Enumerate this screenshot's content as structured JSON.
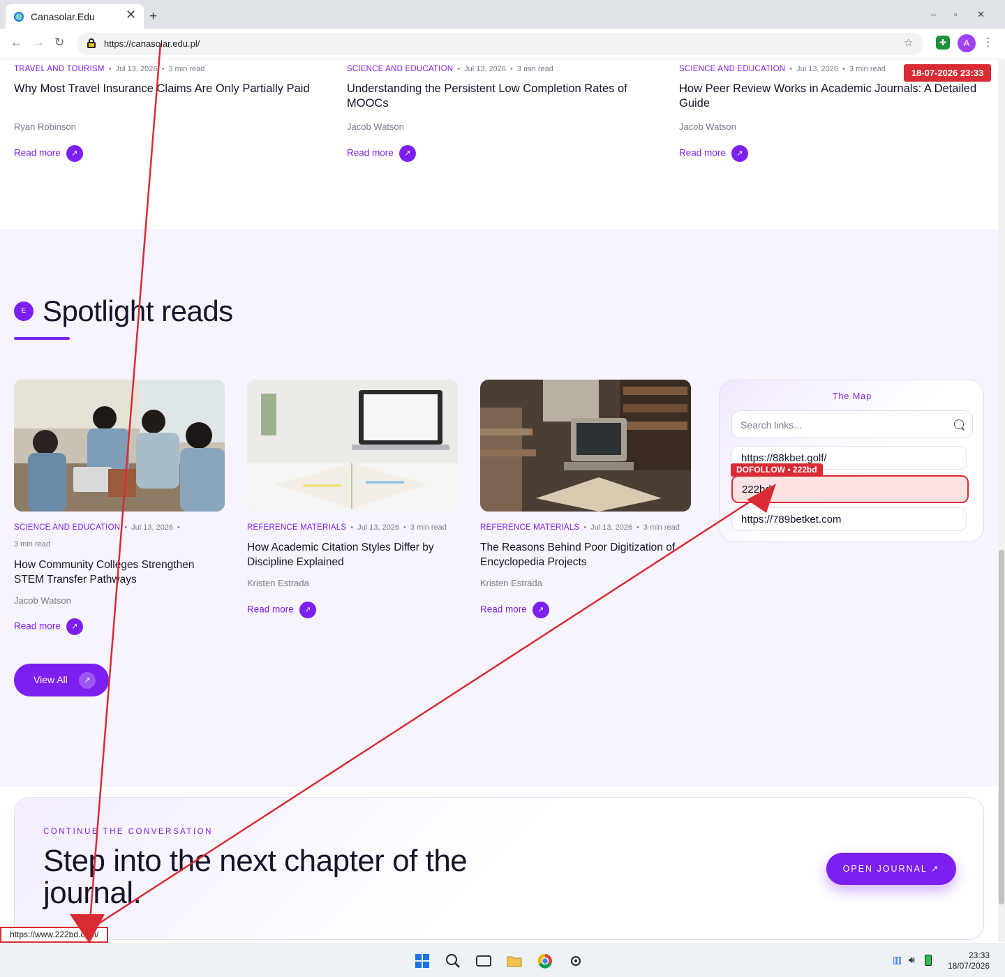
{
  "browser": {
    "tab_title": "Canasolar.Edu",
    "url": "https://canasolar.edu.pl/",
    "avatar_letter": "A",
    "new_tab": "+",
    "win_min": "–",
    "win_max": "▫",
    "win_close": "✕",
    "tab_close": "✕",
    "back": "←",
    "forward": "→",
    "reload": "↻",
    "star": "☆",
    "menu": "⋮"
  },
  "top_articles": [
    {
      "category": "TRAVEL AND TOURISM",
      "date": "Jul 13, 2026",
      "read_time": "3 min read",
      "title": "Why Most Travel Insurance Claims Are Only Partially Paid",
      "author": "Ryan Robinson",
      "read_more": "Read more"
    },
    {
      "category": "SCIENCE AND EDUCATION",
      "date": "Jul 13, 2026",
      "read_time": "3 min read",
      "title": "Understanding the Persistent Low Completion Rates of MOOCs",
      "author": "Jacob Watson",
      "read_more": "Read more"
    },
    {
      "category": "SCIENCE AND EDUCATION",
      "date": "Jul 13, 2026",
      "read_time": "3 min read",
      "title": "How Peer Review Works in Academic Journals: A Detailed Guide",
      "author": "Jacob Watson",
      "read_more": "Read more"
    }
  ],
  "spotlight": {
    "badge": "E",
    "heading": "Spotlight reads",
    "articles": [
      {
        "category": "SCIENCE AND EDUCATION",
        "date": "Jul 13, 2026",
        "read_time": "3 min read",
        "title": "How Community Colleges Strengthen STEM Transfer Pathways",
        "author": "Jacob Watson",
        "read_more": "Read more"
      },
      {
        "category": "REFERENCE MATERIALS",
        "date": "Jul 13, 2026",
        "read_time": "3 min read",
        "title": "How Academic Citation Styles Differ by Discipline Explained",
        "author": "Kristen Estrada",
        "read_more": "Read more"
      },
      {
        "category": "REFERENCE MATERIALS",
        "date": "Jul 13, 2026",
        "read_time": "3 min read",
        "title": "The Reasons Behind Poor Digitization of Encyclopedia Projects",
        "author": "Kristen Estrada",
        "read_more": "Read more"
      }
    ],
    "view_all": "View All"
  },
  "map": {
    "title": "The Map",
    "search_placeholder": "Search links...",
    "links": [
      "https://88kbet.golf/",
      "222bd",
      "https://789betket.com"
    ],
    "dofollow_label": "DOFOLLOW • 222bd"
  },
  "cta": {
    "kicker": "CONTINUE THE CONVERSATION",
    "title": "Step into the next chapter of the journal.",
    "button": "OPEN JOURNAL"
  },
  "overlay": {
    "date_badge": "18-07-2026 23:33",
    "status_url": "https://www.222bd.com/"
  },
  "taskbar": {
    "time": "23:33",
    "date": "18/07/2026"
  },
  "colors": {
    "accent": "#7c1ff0",
    "annotation": "#d92b33"
  }
}
